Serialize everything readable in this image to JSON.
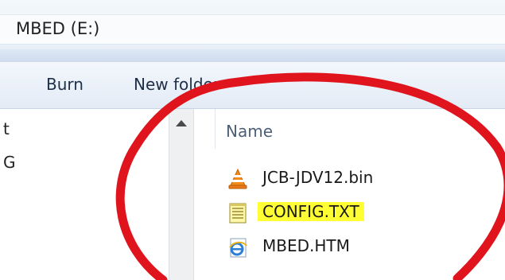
{
  "window": {
    "address_title": "MBED (E:)"
  },
  "toolbar": {
    "burn_label": "Burn",
    "new_folder_label": "New folder"
  },
  "nav": {
    "items": [
      {
        "label": "t"
      },
      {
        "label": "G"
      }
    ]
  },
  "file_list": {
    "column_header": "Name",
    "files": [
      {
        "name": "JCB-JDV12.bin",
        "icon": "vlc-cone-icon"
      },
      {
        "name": "CONFIG.TXT",
        "icon": "text-file-icon",
        "highlighted": true
      },
      {
        "name": "MBED.HTM",
        "icon": "internet-explorer-icon"
      }
    ]
  },
  "annotation": {
    "color": "#e0141c",
    "highlight_color": "#ffff33"
  }
}
